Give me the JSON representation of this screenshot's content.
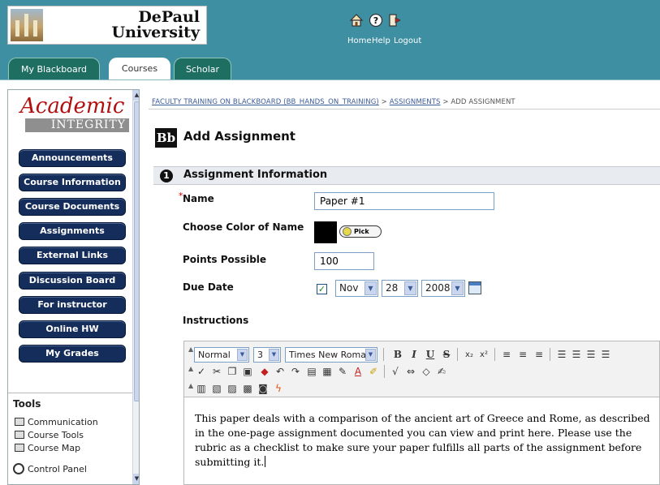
{
  "header": {
    "logo_text_line1": "DePaul",
    "logo_text_line2": "University",
    "nav": [
      {
        "label": "Home",
        "icon": "home-icon"
      },
      {
        "label": "Help",
        "icon": "help-icon"
      },
      {
        "label": "Logout",
        "icon": "logout-icon"
      }
    ]
  },
  "tabs": [
    {
      "label": "My Blackboard",
      "active": false
    },
    {
      "label": "Courses",
      "active": true
    },
    {
      "label": "Scholar",
      "active": false
    }
  ],
  "sidebar": {
    "logo_script": "Academic",
    "logo_band": "INTEGRITY",
    "buttons": [
      "Announcements",
      "Course Information",
      "Course Documents",
      "Assignments",
      "External Links",
      "Discussion Board",
      "For instructor",
      "Online HW",
      "My Grades"
    ],
    "tools_title": "Tools",
    "tools": [
      "Communication",
      "Course Tools",
      "Course Map"
    ],
    "control_panel": "Control Panel"
  },
  "breadcrumb": {
    "course": "FACULTY TRAINING ON BLACKBOARD (BB_HANDS_ON_TRAINING)",
    "section": "ASSIGNMENTS",
    "current": "ADD ASSIGNMENT",
    "separator": ">"
  },
  "page": {
    "bb_logo": "Bb",
    "title": "Add Assignment"
  },
  "section": {
    "number": "1",
    "title": "Assignment Information"
  },
  "form": {
    "required_mark": "*",
    "name_label": "Name",
    "name_value": "Paper #1",
    "color_label": "Choose Color of Name",
    "color_value": "#000000",
    "pick_label": "Pick",
    "points_label": "Points Possible",
    "points_value": "100",
    "due_label": "Due Date",
    "due_checked": true,
    "due_check_mark": "✓",
    "due_month": "Nov",
    "due_day": "28",
    "due_year": "2008",
    "instructions_label": "Instructions"
  },
  "editor": {
    "format": "Normal",
    "size": "3",
    "font": "Times New Roman",
    "body": "This paper deals with a comparison of the ancient art of Greece and Rome, as described in the one-page assignment documented you can view and print here. Please use the rubric as a checklist to make sure your paper fulfills all parts of the assignment before submitting it."
  }
}
